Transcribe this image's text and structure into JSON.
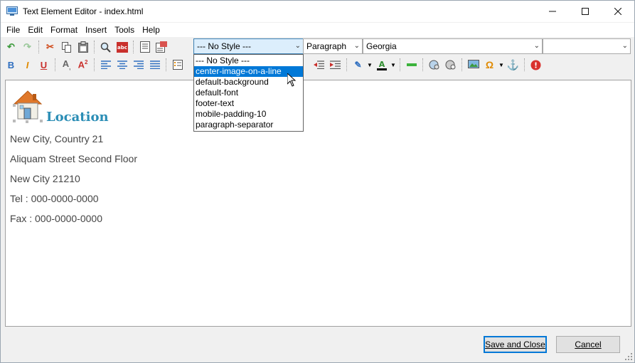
{
  "window": {
    "title": "Text Element Editor - index.html",
    "minimize_icon": "minimize-icon",
    "maximize_icon": "maximize-icon",
    "close_icon": "close-icon"
  },
  "menu": [
    "File",
    "Edit",
    "Format",
    "Insert",
    "Tools",
    "Help"
  ],
  "toolbar": {
    "style_select": "--- No Style ---",
    "block_select": "Paragraph",
    "font_select": "Georgia",
    "size_select": ""
  },
  "style_dropdown": {
    "options": [
      "--- No Style ---",
      "center-image-on-a-line",
      "default-background",
      "default-font",
      "footer-text",
      "mobile-padding-10",
      "paragraph-separator"
    ],
    "highlighted": "center-image-on-a-line"
  },
  "content": {
    "heading": "Location",
    "lines": [
      "New City, Country 21",
      "Aliquam Street Second Floor",
      "New City 21210",
      "Tel : 000-0000-0000",
      "Fax : 000-0000-0000"
    ]
  },
  "buttons": {
    "save": "Save and Close",
    "cancel": "Cancel"
  },
  "colors": {
    "heading": "#2a8db5",
    "selection": "#0078d7"
  }
}
